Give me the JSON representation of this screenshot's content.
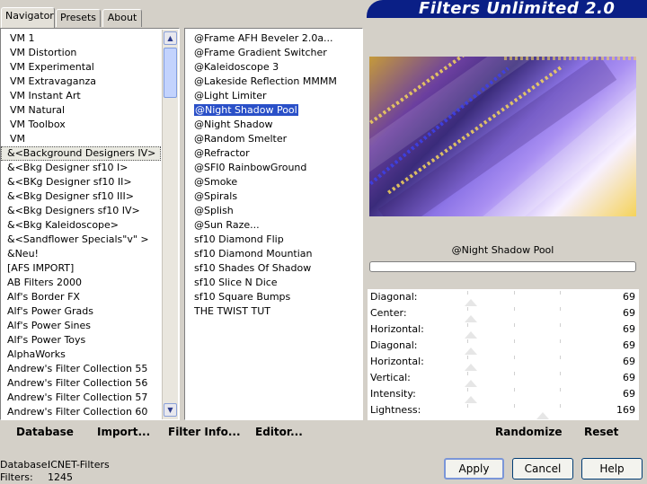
{
  "tabs": [
    "Navigator",
    "Presets",
    "About"
  ],
  "banner_title": "Filters Unlimited 2.0",
  "categories": [
    "VM 1",
    "VM Distortion",
    "VM Experimental",
    "VM Extravaganza",
    "VM Instant Art",
    "VM Natural",
    "VM Toolbox",
    "VM",
    "&<Background Designers IV>",
    "&<Bkg Designer sf10 I>",
    "&<BKg Designer sf10 II>",
    "&<Bkg Designer sf10 III>",
    "&<Bkg Designers sf10 IV>",
    "&<Bkg Kaleidoscope>",
    "&<Sandflower Specials\"v\" >",
    "&Neu!",
    "[AFS IMPORT]",
    "AB Filters 2000",
    "Alf's Border FX",
    "Alf's Power Grads",
    "Alf's Power Sines",
    "Alf's Power Toys",
    "AlphaWorks",
    "Andrew's Filter Collection 55",
    "Andrew's Filter Collection 56",
    "Andrew's Filter Collection 57",
    "Andrew's Filter Collection 60"
  ],
  "selected_category": "&<Background Designers IV>",
  "filters": [
    "@Frame AFH Beveler 2.0a...",
    "@Frame Gradient Switcher",
    "@Kaleidoscope 3",
    "@Lakeside Reflection MMMM",
    "@Light Limiter",
    "@Night Shadow Pool",
    "@Night Shadow",
    "@Random Smelter",
    "@Refractor",
    "@SFI0 RainbowGround",
    "@Smoke",
    "@Spirals",
    "@Splish",
    "@Sun Raze...",
    "sf10 Diamond Flip",
    "sf10 Diamond Mountian",
    "sf10 Shades Of Shadow",
    "sf10 Slice N Dice",
    "sf10 Square Bumps",
    "THE TWIST TUT"
  ],
  "selected_filter": "@Night Shadow Pool",
  "toolbar": {
    "database": "Database",
    "import": "Import...",
    "filter_info": "Filter Info...",
    "editor": "Editor...",
    "randomize": "Randomize",
    "reset": "Reset"
  },
  "filter_name": "@Night Shadow Pool",
  "sliders": [
    {
      "label": "Diagonal:",
      "value": "69",
      "fraction": 0.27
    },
    {
      "label": "Center:",
      "value": "69",
      "fraction": 0.27
    },
    {
      "label": "Horizontal:",
      "value": "69",
      "fraction": 0.27
    },
    {
      "label": "Diagonal:",
      "value": "69",
      "fraction": 0.27
    },
    {
      "label": "Horizontal:",
      "value": "69",
      "fraction": 0.27
    },
    {
      "label": "Vertical:",
      "value": "69",
      "fraction": 0.27
    },
    {
      "label": "Intensity:",
      "value": "69",
      "fraction": 0.27
    },
    {
      "label": "Lightness:",
      "value": "169",
      "fraction": 0.66
    }
  ],
  "status": {
    "database_label": "Database:",
    "database_value": "ICNET-Filters",
    "filters_label": "Filters:",
    "filters_value": "1245"
  },
  "buttons": {
    "apply": "Apply",
    "cancel": "Cancel",
    "help": "Help"
  },
  "colors": {
    "banner": "#0a1f86",
    "selection": "#2a50c8",
    "window": "#d4d0c8"
  }
}
